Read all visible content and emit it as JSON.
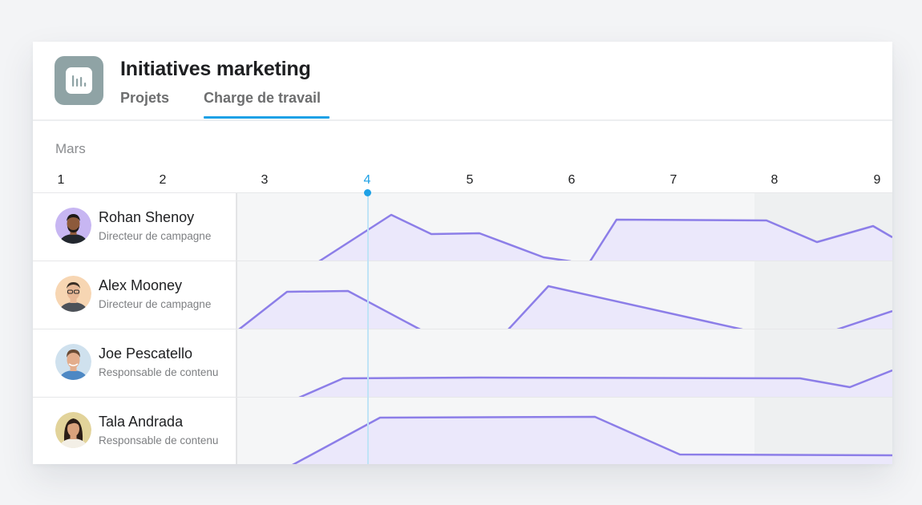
{
  "app": {
    "title": "Initiatives marketing",
    "icon": "bar-chart-icon"
  },
  "tabs": [
    {
      "label": "Projets",
      "active": false
    },
    {
      "label": "Charge de travail",
      "active": true
    }
  ],
  "timeline": {
    "month": "Mars",
    "days": [
      "1",
      "2",
      "3",
      "4",
      "5",
      "6",
      "7",
      "8",
      "9"
    ],
    "today": "4"
  },
  "colors": {
    "accent": "#1ea1e6",
    "workload_line": "#8c7ee8",
    "workload_fill": "#ebe8fb",
    "app_icon_bg": "#8fa3a5"
  },
  "people": [
    {
      "name": "Rohan Shenoy",
      "role": "Directeur de campagne",
      "avatar_bg": "#c7b6f2",
      "skin": "#8d5a3b",
      "hair": "#1e1a18",
      "shirt": "#22272e"
    },
    {
      "name": "Alex Mooney",
      "role": "Directeur de campagne",
      "avatar_bg": "#f7d6b3",
      "skin": "#e8b896",
      "hair": "#3a2e25",
      "shirt": "#4d5259"
    },
    {
      "name": "Joe Pescatello",
      "role": "Responsable de contenu",
      "avatar_bg": "#cfe1ee",
      "skin": "#e3ad8c",
      "hair": "#6a4a33",
      "shirt": "#4d88c4"
    },
    {
      "name": "Tala Andrada",
      "role": "Responsable de contenu",
      "avatar_bg": "#e2d39a",
      "skin": "#d9a27c",
      "hair": "#2b1d16",
      "shirt": "#f3efe6"
    }
  ]
}
